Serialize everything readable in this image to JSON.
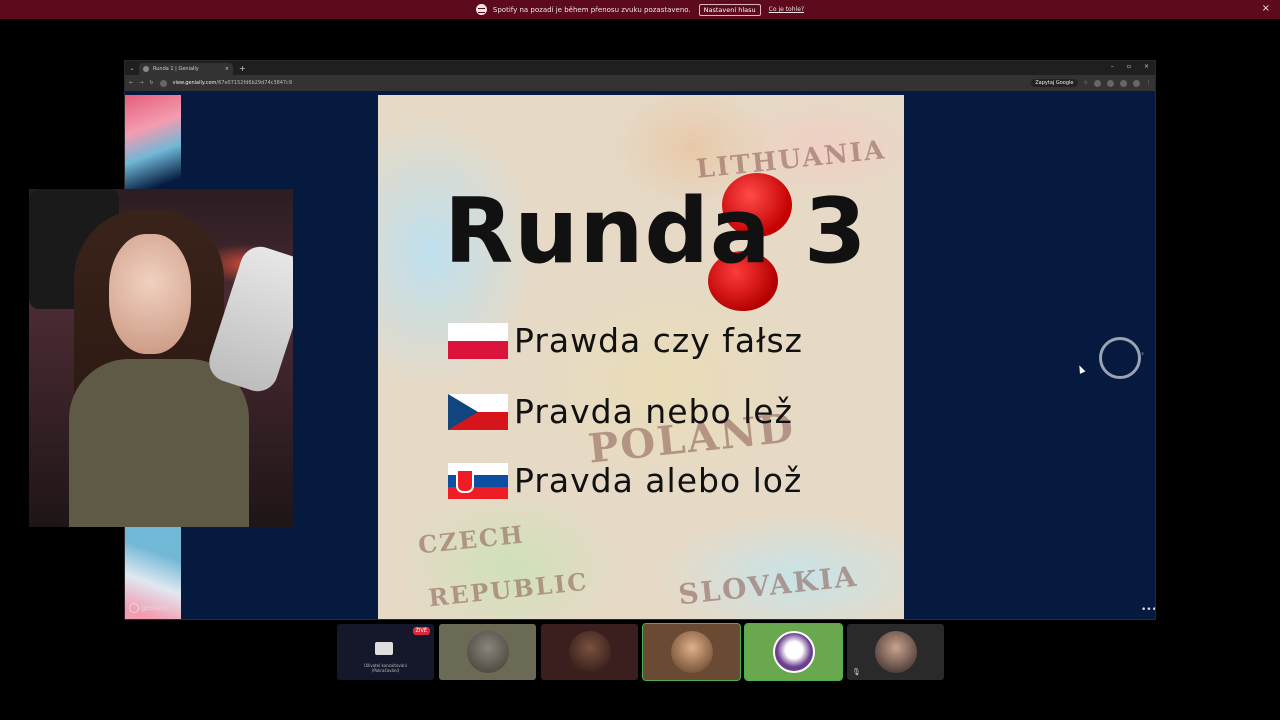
{
  "notification": {
    "message": "Spotify na pozadí je během přenosu zvuku pozastaveno.",
    "button": "Nastavení hlasu",
    "link": "Co je tohle?",
    "close": "×"
  },
  "browser": {
    "tab_dropdown": "⌄",
    "tab_title": "Runda 1 | Genially",
    "tab_close": "×",
    "new_tab": "+",
    "win_minimize": "–",
    "win_restore": "▫",
    "win_close": "×",
    "url_domain": "view.genially.com",
    "url_path": "/67e07152fd6b29d74c3847c9",
    "zapytaj": "Zapytaj Google"
  },
  "slide": {
    "title": "Runda 3",
    "rows": [
      {
        "flag": "poland-flag",
        "text": "Prawda czy fałsz"
      },
      {
        "flag": "czech-flag",
        "text": "Pravda nebo lež"
      },
      {
        "flag": "slovakia-flag",
        "text": "Pravda alebo lož"
      }
    ],
    "map_labels": [
      "LITHUANIA",
      "POLAND",
      "CZECH",
      "REPUBLIC",
      "SLOVAKIA"
    ]
  },
  "genially_logo": "genially",
  "controls": {
    "next_arrow": "›",
    "more": "•••"
  },
  "participants": [
    {
      "name": "screen-share-tile",
      "live_badge": "ŽIVĚ",
      "caption_line1": "Uživatel konzultování",
      "caption_line2": "(Pokračování)"
    },
    {
      "name": "participant-seal"
    },
    {
      "name": "participant-dark"
    },
    {
      "name": "participant-glasses"
    },
    {
      "name": "participant-flag-avatar"
    },
    {
      "name": "participant-woman",
      "muted_icon": "🎙"
    }
  ]
}
